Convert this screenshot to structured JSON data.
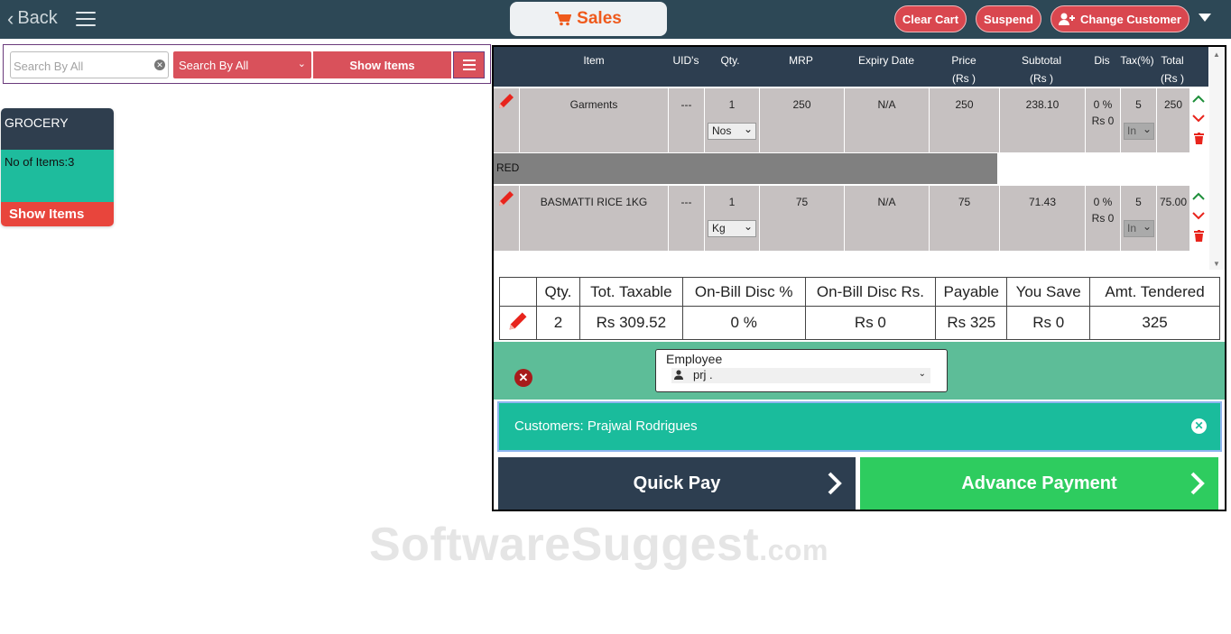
{
  "topbar": {
    "back_label": "Back",
    "title": "Sales",
    "clear_cart": "Clear Cart",
    "suspend": "Suspend",
    "change_customer": "Change Customer",
    "accent": "#ef5a1c",
    "bar_color": "#2d4856"
  },
  "search": {
    "placeholder": "Search By All",
    "value": "",
    "search_by": "Search By All",
    "show_items": "Show Items"
  },
  "category": {
    "name": "GROCERY",
    "count_label": "No of Items:3",
    "button": "Show Items"
  },
  "cart": {
    "headers": [
      "Item",
      "UID's",
      "Qty.",
      "MRP",
      "Expiry Date",
      "Price",
      "(Rs )",
      "Subtotal",
      "(Rs )",
      "Dis",
      "Tax(%)",
      "Total",
      "(Rs )"
    ],
    "rows": [
      {
        "item": "Garments",
        "uid": "---",
        "qty": "1",
        "unit": "Nos",
        "mrp": "250",
        "expiry": "N/A",
        "price": "250",
        "subtotal": "238.10",
        "dis_pct": "0 %",
        "dis_rs": "Rs 0",
        "tax": "5",
        "tax_type": "In",
        "total": "250",
        "note": "RED"
      },
      {
        "item": "BASMATTI RICE 1KG",
        "uid": "---",
        "qty": "1",
        "unit": "Kg",
        "mrp": "75",
        "expiry": "N/A",
        "price": "75",
        "subtotal": "71.43",
        "dis_pct": "0 %",
        "dis_rs": "Rs 0",
        "tax": "5",
        "tax_type": "In",
        "total": "75.00"
      }
    ]
  },
  "summary": {
    "headers": [
      "Qty.",
      "Tot. Taxable",
      "On-Bill Disc %",
      "On-Bill Disc Rs.",
      "Payable",
      "You Save",
      "Amt. Tendered"
    ],
    "values": [
      "2",
      "Rs 309.52",
      "0 %",
      "Rs 0",
      "Rs 325",
      "Rs 0",
      "325"
    ]
  },
  "employee": {
    "label": "Employee",
    "selected": "prj ."
  },
  "customer": {
    "text": "Customers: Prajwal Rodrigues"
  },
  "payment": {
    "quick_pay": "Quick Pay",
    "advance_payment": "Advance Payment"
  },
  "watermark": {
    "main": "SoftwareSuggest",
    "suffix": ".com"
  },
  "icons": [
    "back-chevron-icon",
    "hamburger-icon",
    "cart-icon",
    "add-user-icon",
    "caret-down-icon",
    "clear-search-icon",
    "list-icon",
    "edit-icon",
    "move-up-icon",
    "move-down-icon",
    "delete-icon",
    "cancel-icon",
    "person-icon",
    "close-icon",
    "arrow-right-icon"
  ]
}
